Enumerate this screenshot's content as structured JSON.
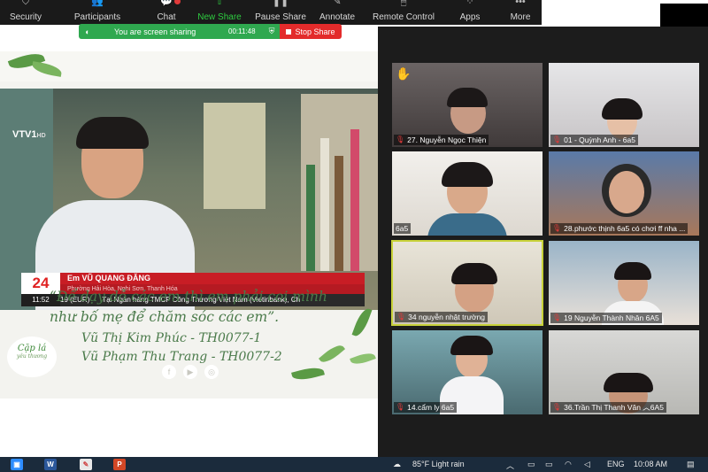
{
  "toolbar": {
    "items": [
      {
        "label": "Security",
        "icon": "shield-icon"
      },
      {
        "label": "Participants",
        "icon": "participants-icon"
      },
      {
        "label": "Chat",
        "icon": "chat-icon"
      },
      {
        "label": "New Share",
        "icon": "share-icon"
      },
      {
        "label": "Pause Share",
        "icon": "pause-icon"
      },
      {
        "label": "Annotate",
        "icon": "pen-icon"
      },
      {
        "label": "Remote Control",
        "icon": "mouse-icon"
      },
      {
        "label": "Apps",
        "icon": "apps-icon"
      },
      {
        "label": "More",
        "icon": "more-icon"
      }
    ],
    "accent_color": "#2ecc40"
  },
  "share_banner": {
    "text": "You are screen sharing",
    "timer": "00:11:48",
    "stop_label": "Stop Share"
  },
  "slide": {
    "channel_logo": "VTV1",
    "channel_logo_suffix": "HD",
    "news_badge": "24",
    "name": "Em VŨ QUANG ĐĂNG",
    "place": "Phường Hải Hòa, Nghi Sơn, Thanh Hóa",
    "time": "11:52",
    "ticker_prefix": "19 (EUR)",
    "ticker": "Tại Ngân hàng TMCP Công Thương Việt Nam (Vietinbank), Ch",
    "quote_line1": "“Để dạy dỗ các em thì em phải coi mình",
    "quote_line2": "như bố mẹ để chăm sóc các em”.",
    "signature1": "Vũ Thị Kim Phúc - TH0077-1",
    "signature2": "Vũ Phạm Thu Trang - TH0077-2",
    "logo_text": "Cặp lá",
    "logo_subtext": "yêu thương",
    "social_icons": [
      "facebook-icon",
      "youtube-icon",
      "instagram-icon"
    ]
  },
  "gallery": {
    "participants": [
      {
        "name": "27. Nguyễn Ngọc Thiện",
        "muted": true,
        "hand_raised": true
      },
      {
        "name": "01 - Quỳnh Anh - 6a5",
        "muted": true,
        "hand_raised": false
      },
      {
        "name": "6a5",
        "muted": false,
        "hand_raised": false
      },
      {
        "name": "28.phước thịnh 6a5 có chơi ff nha ...",
        "muted": true,
        "hand_raised": false
      },
      {
        "name": "34 nguyễn nhật trường",
        "muted": true,
        "hand_raised": false,
        "active": true
      },
      {
        "name": "19 Nguyễn Thành Nhân 6A5",
        "muted": true,
        "hand_raised": false
      },
      {
        "name": "14.cẩm ly 6a5",
        "muted": true,
        "hand_raised": false
      },
      {
        "name": "36.Trần Thị Thanh Vân ︿6A5",
        "muted": true,
        "hand_raised": false
      }
    ]
  },
  "taskbar": {
    "apps": [
      "zoom-icon",
      "word-icon",
      "paint-icon",
      "powerpoint-icon"
    ],
    "weather": "85°F  Light rain",
    "language": "ENG",
    "clock": "10:08 AM"
  }
}
